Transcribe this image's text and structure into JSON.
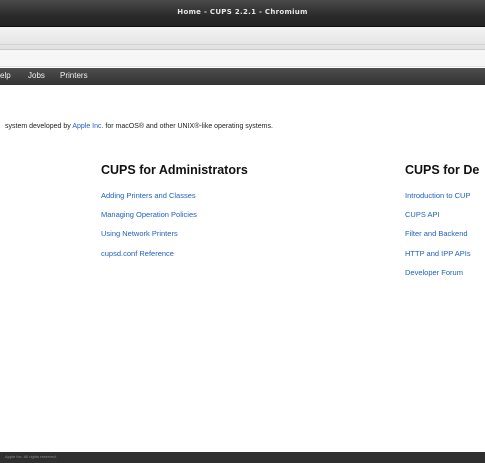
{
  "window": {
    "title": "Home - CUPS 2.2.1 - Chromium"
  },
  "nav": {
    "items": [
      "elp",
      "Jobs",
      "Printers"
    ]
  },
  "intro": {
    "before": "system developed by ",
    "link": "Apple Inc.",
    "after": " for macOS® and other UNIX®-like operating systems."
  },
  "admin": {
    "title": "CUPS for Administrators",
    "links": [
      "Adding Printers and Classes",
      "Managing Operation Policies",
      "Using Network Printers",
      "cupsd.conf Reference"
    ]
  },
  "dev": {
    "title": "CUPS for De",
    "links": [
      "Introduction to CUP",
      "CUPS API",
      "Filter and Backend",
      "HTTP and IPP APIs",
      "Developer Forum"
    ]
  },
  "footer": {
    "text": "Apple Inc. All rights reserved."
  },
  "colors": {
    "link": "#1f5fbf",
    "titlebar": "#2b2b2b",
    "navbar": "#3c3c3c"
  }
}
